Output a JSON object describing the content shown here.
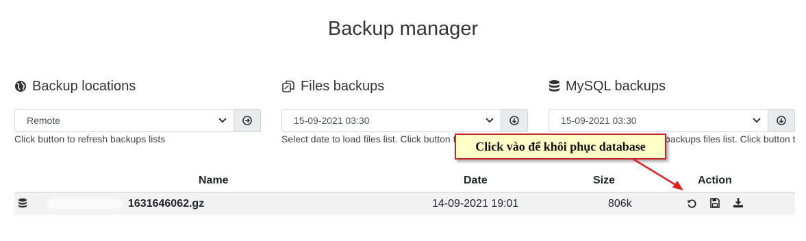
{
  "page": {
    "title": "Backup manager"
  },
  "locations": {
    "heading": "Backup locations",
    "icon": "globe-icon",
    "selected": "Remote",
    "button_icon": "circle-arrow-right-icon",
    "help": "Click button to refresh backups lists"
  },
  "files": {
    "heading": "Files backups",
    "icon": "copy-files-icon",
    "selected": "15-09-2021 03:30",
    "button_icon": "circle-download-icon",
    "help": "Select date to load files list. Click button to reload"
  },
  "mysql": {
    "heading": "MySQL backups",
    "icon": "database-icon",
    "selected": "15-09-2021 03:30",
    "button_icon": "circle-download-icon",
    "help": "Select date to load MySQL backups files list. Click button to reload"
  },
  "table": {
    "headers": {
      "name": "Name",
      "date": "Date",
      "size": "Size",
      "action": "Action"
    },
    "rows": [
      {
        "icon": "database-icon",
        "name": "1631646062.gz",
        "date": "14-09-2021 19:01",
        "size": "806k",
        "actions": [
          "restore-icon",
          "save-icon",
          "download-icon"
        ]
      }
    ]
  },
  "annotation": {
    "text": "Click vào để khôi phục database",
    "color": "#c0292b"
  }
}
